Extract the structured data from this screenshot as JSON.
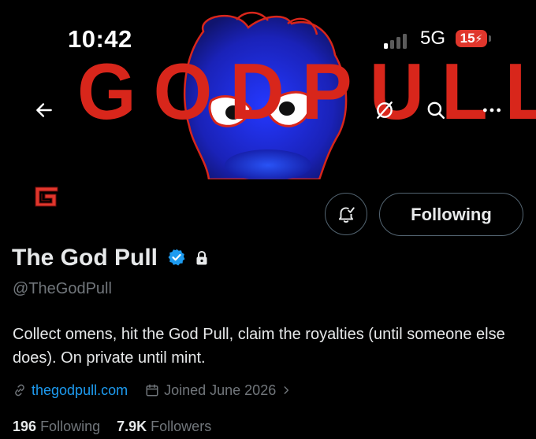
{
  "status_bar": {
    "time": "10:42",
    "network": "5G",
    "battery": "15"
  },
  "banner": {
    "title": "GODPULL",
    "title_color": "#d8261b",
    "art": "blue-creature-mascot"
  },
  "header": {
    "back_icon": "arrow-left-icon",
    "grok_icon": "grok-icon",
    "search_icon": "search-icon",
    "more_icon": "more-icon"
  },
  "profile": {
    "avatar_letter": "G",
    "name": "The God Pull",
    "verified": true,
    "protected": true,
    "handle": "@TheGodPull",
    "bio": "Collect omens, hit the God Pull, claim the royalties (until someone else does). On private until mint.",
    "website": "thegodpull.com",
    "joined": "Joined June 2026"
  },
  "actions": {
    "follow_label": "Following",
    "notify_icon": "bell-check-icon"
  },
  "stats": {
    "following_count": "196",
    "following_label": "Following",
    "followers_count": "7.9K",
    "followers_label": "Followers"
  },
  "colors": {
    "accent_blue": "#1d9bf0",
    "battery_red": "#e0362c",
    "banner_blue": "#1f2fd8"
  }
}
